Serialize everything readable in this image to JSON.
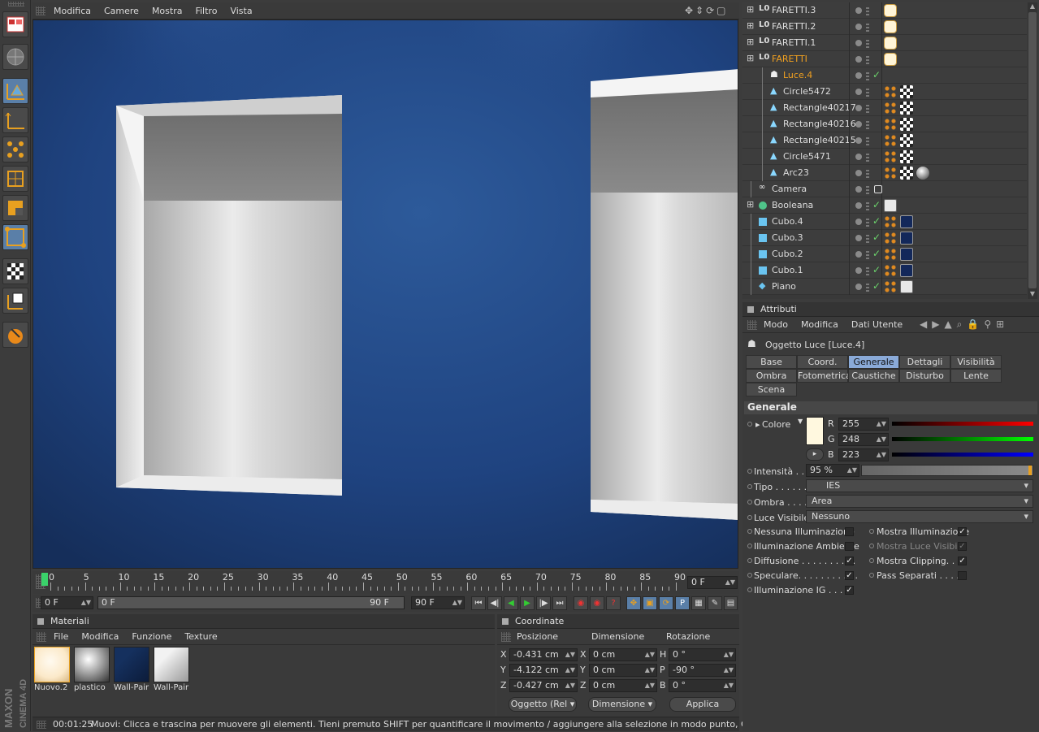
{
  "viewport_menu": [
    "Modifica",
    "Camere",
    "Mostra",
    "Filtro",
    "Vista"
  ],
  "objects": [
    {
      "name": "FARETTI.3",
      "icon": "null-icon",
      "tag": "lamp",
      "expand": true,
      "indent": 0
    },
    {
      "name": "FARETTI.2",
      "icon": "null-icon",
      "tag": "lamp",
      "expand": true,
      "indent": 0
    },
    {
      "name": "FARETTI.1",
      "icon": "null-icon",
      "tag": "lamp",
      "expand": true,
      "indent": 0
    },
    {
      "name": "FARETTI",
      "icon": "null-icon",
      "tag": "lamp",
      "expand": true,
      "indent": 0,
      "selected": true
    },
    {
      "name": "Luce.4",
      "icon": "ies-light-icon",
      "tag": "",
      "indent": 1,
      "selected": true,
      "check": true
    },
    {
      "name": "Circle5472",
      "icon": "spline-icon",
      "tag": "dots-checker",
      "indent": 1
    },
    {
      "name": "Rectangle40217",
      "icon": "spline-icon",
      "tag": "dots-checker",
      "indent": 1
    },
    {
      "name": "Rectangle40216",
      "icon": "spline-icon",
      "tag": "dots-checker",
      "indent": 1
    },
    {
      "name": "Rectangle40215",
      "icon": "spline-icon",
      "tag": "dots-checker",
      "indent": 1
    },
    {
      "name": "Circle5471",
      "icon": "spline-icon",
      "tag": "dots-checker",
      "indent": 1
    },
    {
      "name": "Arc23",
      "icon": "spline-icon",
      "tag": "dots-checker-ball",
      "indent": 1
    },
    {
      "name": "Camera",
      "icon": "camera-icon",
      "tag": "target",
      "indent": 0
    },
    {
      "name": "Booleana",
      "icon": "boole-icon",
      "tag": "white",
      "expand": true,
      "indent": 0,
      "check": true
    },
    {
      "name": "Cubo.4",
      "icon": "cube-icon",
      "tag": "dots-cube",
      "indent": 0,
      "check": true
    },
    {
      "name": "Cubo.3",
      "icon": "cube-icon",
      "tag": "dots-cube",
      "indent": 0,
      "check": true
    },
    {
      "name": "Cubo.2",
      "icon": "cube-icon",
      "tag": "dots-cube",
      "indent": 0,
      "check": true
    },
    {
      "name": "Cubo.1",
      "icon": "cube-icon",
      "tag": "dots-cube",
      "indent": 0,
      "check": true
    },
    {
      "name": "Piano",
      "icon": "plane-icon",
      "tag": "dots-white",
      "indent": 0,
      "check": true
    }
  ],
  "attributes": {
    "title": "Attributi",
    "menu": [
      "Modo",
      "Modifica",
      "Dati Utente"
    ],
    "object_label": "Oggetto Luce [Luce.4]",
    "tabs_row1": [
      "Base",
      "Coord.",
      "Generale",
      "Dettagli",
      "Visibilità"
    ],
    "tabs_row2": [
      "Ombra",
      "Fotometrica",
      "Caustiche",
      "Disturbo",
      "Lente"
    ],
    "tabs_row3": [
      "Scena"
    ],
    "active_tab": "Generale",
    "section": "Generale",
    "colore_label": "Colore",
    "r_label": "R",
    "r": "255",
    "g_label": "G",
    "g": "248",
    "b_label": "B",
    "b": "223",
    "intensita_label": "Intensità . . .",
    "intensita": "95 %",
    "tipo_label": "Tipo . . . . . . .",
    "tipo": "IES",
    "ombra_label": "Ombra . . . .",
    "ombra": "Area",
    "luce_visibile_label": "Luce Visibile",
    "luce_visibile": "Nessuno",
    "checks_left": [
      {
        "label": "Nessuna Illuminazione",
        "checked": false
      },
      {
        "label": "Illuminazione Ambiente",
        "checked": false
      },
      {
        "label": "Diffusione . . . . . . . . . .",
        "checked": true
      },
      {
        "label": "Speculare. . . . . . . . . . .",
        "checked": true
      },
      {
        "label": "Illuminazione IG . . . . .",
        "checked": true
      }
    ],
    "checks_right": [
      {
        "label": "Mostra Illuminazione",
        "checked": true,
        "disabled": false
      },
      {
        "label": "Mostra Luce Visibile",
        "checked": true,
        "disabled": true
      },
      {
        "label": "Mostra Clipping. . . .",
        "checked": true,
        "disabled": false
      },
      {
        "label": "Pass Separati . . . . .",
        "checked": false,
        "disabled": false
      }
    ],
    "color_hex": "#FFF8DF"
  },
  "timeline": {
    "ticks": [
      "0",
      "5",
      "10",
      "15",
      "20",
      "25",
      "30",
      "35",
      "40",
      "45",
      "50",
      "55",
      "60",
      "65",
      "70",
      "75",
      "80",
      "85",
      "90"
    ],
    "current_frame": "0 F",
    "start": "0 F",
    "range_start": "0 F",
    "range_end": "90 F",
    "end": "90 F"
  },
  "materials": {
    "title": "Materiali",
    "menu": [
      "File",
      "Modifica",
      "Funzione",
      "Texture"
    ],
    "items": [
      "Nuovo.2",
      "plastico",
      "Wall-Pair",
      "Wall-Pair"
    ]
  },
  "coordinates": {
    "title": "Coordinate",
    "headers": [
      "Posizione",
      "Dimensione",
      "Rotazione"
    ],
    "rows": [
      {
        "axis": "X",
        "pos": "-0.431 cm",
        "dim_axis": "X",
        "dim": "0 cm",
        "rot_axis": "H",
        "rot": "0 °"
      },
      {
        "axis": "Y",
        "pos": "-4.122 cm",
        "dim_axis": "Y",
        "dim": "0 cm",
        "rot_axis": "P",
        "rot": "-90 °"
      },
      {
        "axis": "Z",
        "pos": "-0.427 cm",
        "dim_axis": "Z",
        "dim": "0 cm",
        "rot_axis": "B",
        "rot": "0 °"
      }
    ],
    "mode_btn": "Oggetto (Rel",
    "dim_btn": "Dimensione",
    "apply_btn": "Applica"
  },
  "status": {
    "time": "00:01:25",
    "message": "Muovi: Clicca e trascina per muovere gli elementi. Tieni premuto SHIFT per quantificare il movimento / aggiungere alla selezione in modo punto, CTRL per rimuovere."
  },
  "brand": {
    "line1": "MAXON",
    "line2": "CINEMA 4D"
  }
}
